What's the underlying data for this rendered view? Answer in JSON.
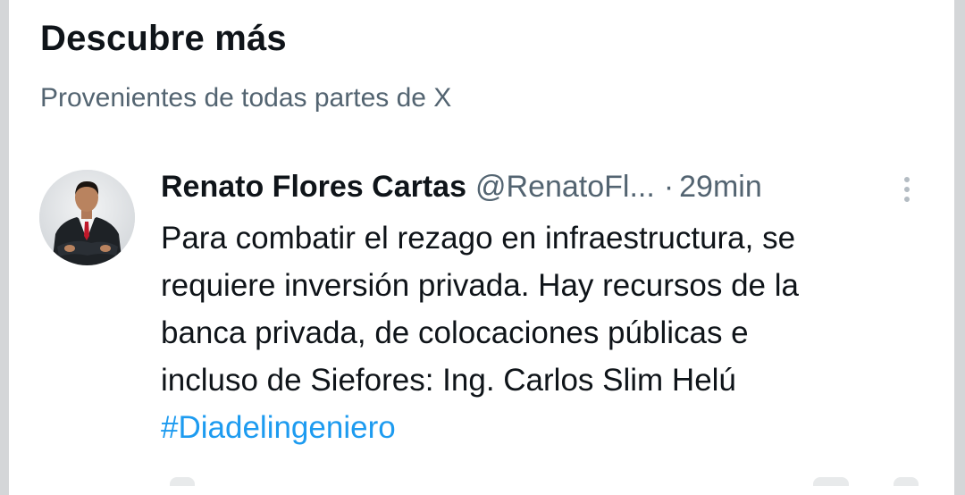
{
  "section": {
    "title": "Descubre más",
    "subtitle": "Provenientes de todas partes de X"
  },
  "post": {
    "author_name": "Renato Flores Cartas",
    "author_handle": "@RenatoFl...",
    "separator": "·",
    "time_ago": "29min",
    "text_lines": [
      "Para combatir el rezago en infraestructura, se",
      "requiere inversión privada. Hay recursos de la",
      "banca privada, de colocaciones públicas e",
      "incluso de Siefores: Ing. Carlos Slim Helú"
    ],
    "hashtag": "#Diadelingeniero"
  },
  "icons": {
    "more": "more-vertical-icon",
    "avatar": "avatar"
  },
  "colors": {
    "text_primary": "#0f1419",
    "text_secondary": "#536471",
    "link": "#1d9bf0",
    "frame_border": "#d4d6d8"
  }
}
